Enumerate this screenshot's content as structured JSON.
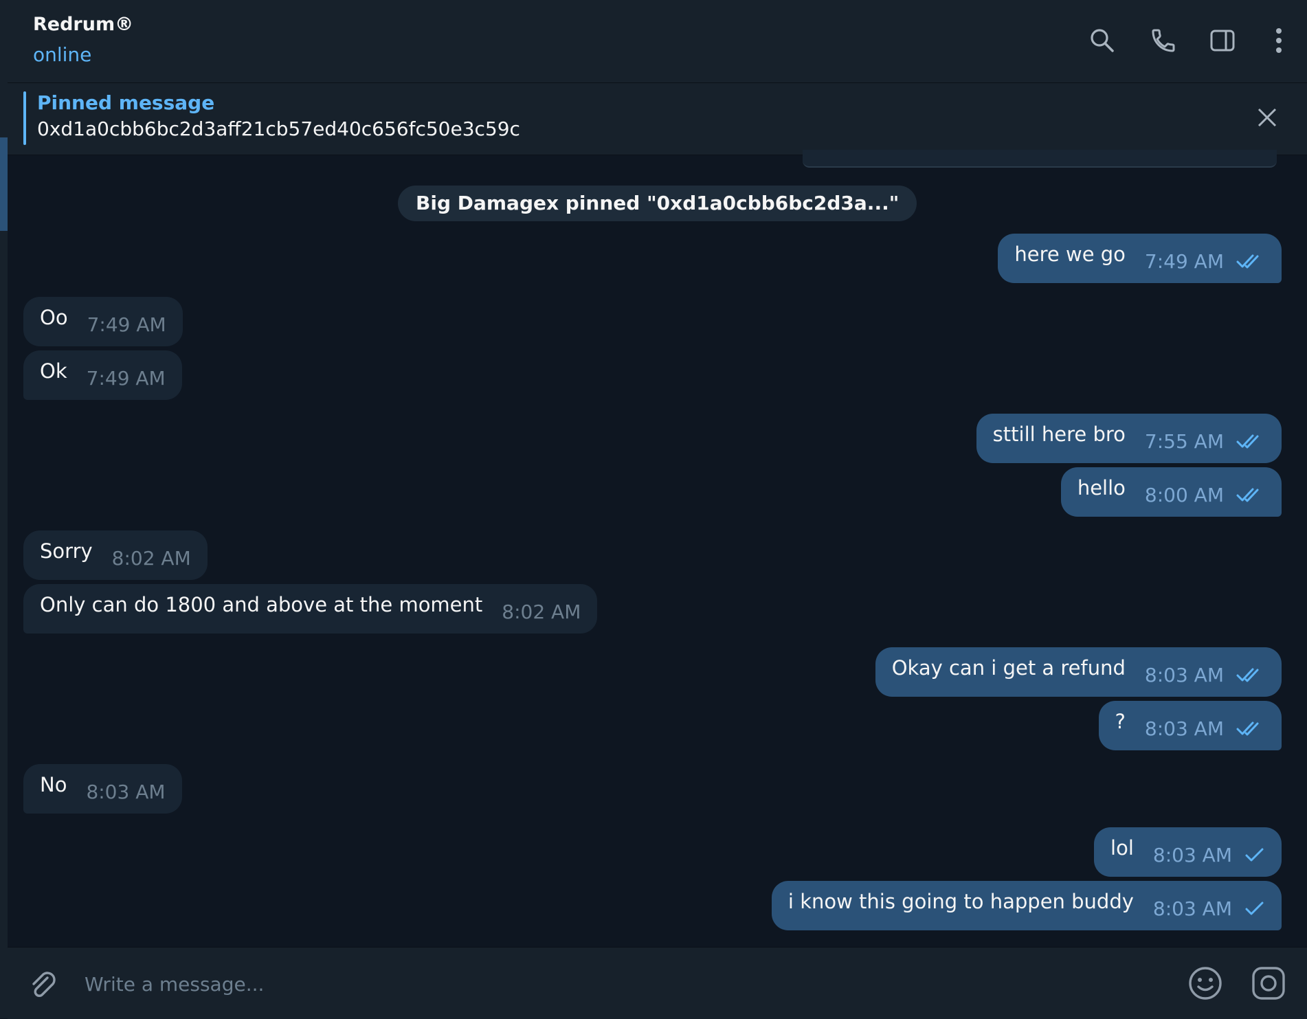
{
  "header": {
    "title": "Redrum®",
    "status": "online",
    "icons": [
      "search-icon",
      "phone-icon",
      "sidebar-toggle-icon",
      "more-icon"
    ]
  },
  "pinned": {
    "title": "Pinned message",
    "text": "0xd1a0cbb6bc2d3aff21cb57ed40c656fc50e3c59c"
  },
  "service_message": "Big Damagex pinned \"0xd1a0cbb6bc2d3a...\"",
  "messages": [
    {
      "dir": "out",
      "text": "here we go",
      "time": "7:49 AM",
      "status": "read"
    },
    {
      "dir": "in",
      "text": "Oo",
      "time": "7:49 AM"
    },
    {
      "dir": "in",
      "text": "Ok",
      "time": "7:49 AM"
    },
    {
      "dir": "out",
      "text": "sttill here bro",
      "time": "7:55 AM",
      "status": "read"
    },
    {
      "dir": "out",
      "text": "hello",
      "time": "8:00 AM",
      "status": "read"
    },
    {
      "dir": "in",
      "text": "Sorry",
      "time": "8:02 AM"
    },
    {
      "dir": "in",
      "text": "Only can do 1800 and above at the moment",
      "time": "8:02 AM"
    },
    {
      "dir": "out",
      "text": "Okay can i get a refund",
      "time": "8:03 AM",
      "status": "read"
    },
    {
      "dir": "out",
      "text": "?",
      "time": "8:03 AM",
      "status": "read"
    },
    {
      "dir": "in",
      "text": "No",
      "time": "8:03 AM"
    },
    {
      "dir": "out",
      "text": "lol",
      "time": "8:03 AM",
      "status": "sent"
    },
    {
      "dir": "out",
      "text": "i know this going to happen buddy",
      "time": "8:03 AM",
      "status": "sent"
    }
  ],
  "composer": {
    "placeholder": "Write a message...",
    "icons": [
      "attach-icon",
      "emoji-icon",
      "camera-icon"
    ]
  },
  "colors": {
    "background": "#0e1621",
    "panel": "#17212b",
    "incoming_bubble": "#182533",
    "outgoing_bubble": "#2b5278",
    "accent": "#5eb5f7"
  }
}
